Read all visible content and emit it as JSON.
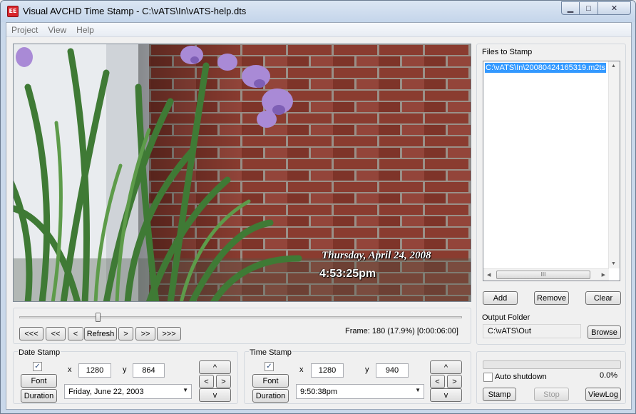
{
  "window": {
    "title": "Visual AVCHD Time Stamp - C:\\vATS\\In\\vATS-help.dts",
    "app_icon_text": "EE",
    "minimize_glyph": "▁",
    "maximize_glyph": "□",
    "close_glyph": "✕"
  },
  "menu": [
    "Project",
    "View",
    "Help"
  ],
  "preview": {
    "overlay_date": "Thursday, April 24, 2008",
    "overlay_time": "4:53:25pm"
  },
  "playback": {
    "buttons": [
      "<<<",
      "<<",
      "<",
      "Refresh",
      ">",
      ">>",
      ">>>"
    ],
    "frame_text": "Frame: 180 (17.9%) [0:00:06:00]",
    "slider_position_percent": 17.9
  },
  "date_stamp": {
    "title": "Date Stamp",
    "enabled": true,
    "check_glyph": "✓",
    "font_label": "Font",
    "duration_label": "Duration",
    "x_label": "x",
    "x_value": "1280",
    "y_label": "y",
    "y_value": "864",
    "format_value": "Friday, June 22, 2003",
    "nudge": {
      "up": "^",
      "left": "<",
      "right": ">",
      "down": "v"
    }
  },
  "time_stamp": {
    "title": "Time Stamp",
    "enabled": true,
    "check_glyph": "✓",
    "font_label": "Font",
    "duration_label": "Duration",
    "x_label": "x",
    "x_value": "1280",
    "y_label": "y",
    "y_value": "940",
    "format_value": "9:50:38pm",
    "nudge": {
      "up": "^",
      "left": "<",
      "right": ">",
      "down": "v"
    }
  },
  "files": {
    "title": "Files to Stamp",
    "items": [
      "C:\\vATS\\In\\20080424165319.m2ts"
    ],
    "add_label": "Add",
    "remove_label": "Remove",
    "clear_label": "Clear",
    "hscroll_grip": "III",
    "scroll_up": "▲",
    "scroll_down": "▼",
    "scroll_left": "◀",
    "scroll_right": "▶"
  },
  "output": {
    "title": "Output Folder",
    "path": "C:\\vATS\\Out",
    "browse_label": "Browse"
  },
  "job": {
    "progress_percent": 0.0,
    "progress_text": "0.0%",
    "auto_shutdown_label": "Auto shutdown",
    "auto_shutdown_checked": false,
    "stamp_label": "Stamp",
    "stop_label": "Stop",
    "viewlog_label": "ViewLog"
  },
  "combo_arrow": "▼",
  "colors": {
    "selection": "#3399ff",
    "titlebar": "#c4d5ea",
    "brick": "#8a3c30",
    "foliage": "#3f7a35",
    "iris": "#a98ad6"
  }
}
